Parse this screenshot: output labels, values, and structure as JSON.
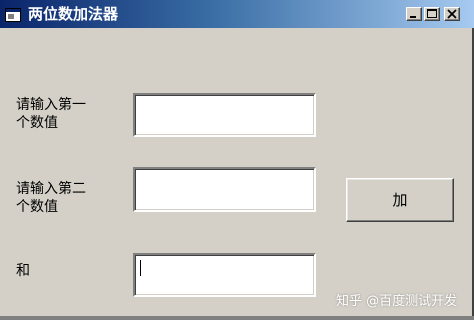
{
  "window": {
    "title": "两位数加法器",
    "icon": "app-window-icon",
    "controls": [
      "minimize-icon",
      "maximize-icon",
      "close-icon"
    ]
  },
  "form": {
    "label_first": "请输入第一个数值",
    "label_first_line1": "请输入第一",
    "label_first_line2": "个数值",
    "label_second_line1": "请输入第二",
    "label_second_line2": "个数值",
    "label_sum": "和",
    "first_value": "",
    "second_value": "",
    "sum_value": "",
    "add_button_label": "加"
  },
  "watermark": "知乎 @百度测试开发",
  "colors": {
    "window_bg": "#d4d0c8",
    "titlebar_start": "#0a246a",
    "titlebar_end": "#a6caf0",
    "input_bg": "#ffffff"
  }
}
